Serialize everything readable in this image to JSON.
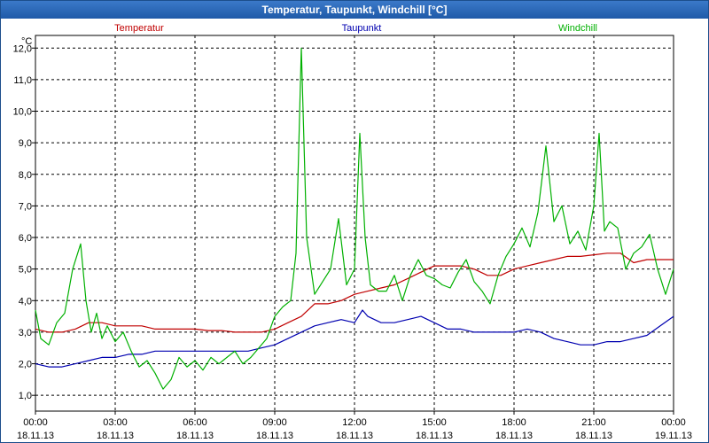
{
  "window": {
    "title": "Temperatur, Taupunkt, Windchill [°C]"
  },
  "chart_data": {
    "type": "line",
    "title": "Temperatur, Taupunkt, Windchill [°C]",
    "ylabel": "°C",
    "ylim": [
      0.5,
      12.4
    ],
    "yticks": [
      1.0,
      2.0,
      3.0,
      4.0,
      5.0,
      6.0,
      7.0,
      8.0,
      9.0,
      10.0,
      11.0,
      12.0
    ],
    "ytick_labels": [
      "1,0",
      "2,0",
      "3,0",
      "4,0",
      "5,0",
      "6,0",
      "7,0",
      "8,0",
      "9,0",
      "10,0",
      "11,0",
      "12,0"
    ],
    "xlim": [
      0,
      24
    ],
    "xticks": [
      {
        "h": 0,
        "time": "00:00",
        "date": "18.11.13"
      },
      {
        "h": 3,
        "time": "03:00",
        "date": "18.11.13"
      },
      {
        "h": 6,
        "time": "06:00",
        "date": "18.11.13"
      },
      {
        "h": 9,
        "time": "09:00",
        "date": "18.11.13"
      },
      {
        "h": 12,
        "time": "12:00",
        "date": "18.11.13"
      },
      {
        "h": 15,
        "time": "15:00",
        "date": "18.11.13"
      },
      {
        "h": 18,
        "time": "18:00",
        "date": "18.11.13"
      },
      {
        "h": 21,
        "time": "21:00",
        "date": "18.11.13"
      },
      {
        "h": 24,
        "time": "00:00",
        "date": "19.11.13"
      }
    ],
    "grid": true,
    "legend": "top",
    "series": [
      {
        "name": "Temperatur",
        "color": "#c00000",
        "x": [
          0,
          0.5,
          1,
          1.5,
          2,
          2.5,
          3,
          3.5,
          4,
          4.5,
          5,
          5.5,
          6,
          6.5,
          7,
          7.5,
          8,
          8.5,
          9,
          9.5,
          10,
          10.5,
          11,
          11.5,
          12,
          12.5,
          13,
          13.5,
          14,
          14.5,
          15,
          15.5,
          16,
          16.5,
          17,
          17.5,
          18,
          18.5,
          19,
          19.5,
          20,
          20.5,
          21,
          21.5,
          22,
          22.5,
          23,
          23.5,
          24
        ],
        "values": [
          3.1,
          3.0,
          3.0,
          3.1,
          3.3,
          3.3,
          3.2,
          3.2,
          3.2,
          3.1,
          3.1,
          3.1,
          3.1,
          3.05,
          3.05,
          3.0,
          3.0,
          3.0,
          3.1,
          3.3,
          3.5,
          3.9,
          3.9,
          4.0,
          4.2,
          4.3,
          4.4,
          4.5,
          4.7,
          4.9,
          5.1,
          5.1,
          5.1,
          5.0,
          4.8,
          4.8,
          5.0,
          5.1,
          5.2,
          5.3,
          5.4,
          5.4,
          5.45,
          5.5,
          5.5,
          5.2,
          5.3,
          5.3,
          5.3
        ]
      },
      {
        "name": "Taupunkt",
        "color": "#0000b0",
        "x": [
          0,
          0.5,
          1,
          1.5,
          2,
          2.5,
          3,
          3.5,
          4,
          4.5,
          5,
          5.5,
          6,
          6.5,
          7,
          7.5,
          8,
          8.5,
          9,
          9.5,
          10,
          10.5,
          11,
          11.5,
          12,
          12.3,
          12.5,
          13,
          13.5,
          14,
          14.5,
          15,
          15.5,
          16,
          16.5,
          17,
          17.5,
          18,
          18.5,
          19,
          19.5,
          20,
          20.5,
          21,
          21.5,
          22,
          22.5,
          23,
          23.5,
          24
        ],
        "values": [
          2.0,
          1.9,
          1.9,
          2.0,
          2.1,
          2.2,
          2.2,
          2.3,
          2.3,
          2.4,
          2.4,
          2.4,
          2.4,
          2.4,
          2.4,
          2.4,
          2.4,
          2.5,
          2.6,
          2.8,
          3.0,
          3.2,
          3.3,
          3.4,
          3.3,
          3.7,
          3.5,
          3.3,
          3.3,
          3.4,
          3.5,
          3.3,
          3.1,
          3.1,
          3.0,
          3.0,
          3.0,
          3.0,
          3.1,
          3.0,
          2.8,
          2.7,
          2.6,
          2.6,
          2.7,
          2.7,
          2.8,
          2.9,
          3.2,
          3.5
        ]
      },
      {
        "name": "Windchill",
        "color": "#00b000",
        "x": [
          0,
          0.2,
          0.5,
          0.8,
          1.1,
          1.4,
          1.7,
          1.9,
          2.1,
          2.3,
          2.5,
          2.7,
          3.0,
          3.3,
          3.6,
          3.9,
          4.2,
          4.5,
          4.8,
          5.1,
          5.4,
          5.7,
          6.0,
          6.3,
          6.6,
          6.9,
          7.2,
          7.5,
          7.8,
          8.1,
          8.4,
          8.7,
          9.0,
          9.3,
          9.6,
          9.8,
          10.0,
          10.2,
          10.5,
          10.8,
          11.1,
          11.4,
          11.7,
          12.0,
          12.2,
          12.4,
          12.6,
          12.9,
          13.2,
          13.5,
          13.8,
          14.1,
          14.4,
          14.7,
          15.0,
          15.3,
          15.6,
          15.9,
          16.2,
          16.5,
          16.8,
          17.1,
          17.4,
          17.7,
          18.0,
          18.3,
          18.6,
          18.9,
          19.2,
          19.5,
          19.8,
          20.1,
          20.4,
          20.7,
          21.0,
          21.2,
          21.4,
          21.6,
          21.9,
          22.2,
          22.5,
          22.8,
          23.1,
          23.4,
          23.7,
          24.0
        ],
        "values": [
          3.7,
          2.8,
          2.6,
          3.3,
          3.6,
          5.0,
          5.8,
          4.0,
          3.0,
          3.6,
          2.8,
          3.2,
          2.7,
          3.0,
          2.4,
          1.9,
          2.1,
          1.7,
          1.2,
          1.5,
          2.2,
          1.9,
          2.1,
          1.8,
          2.2,
          2.0,
          2.2,
          2.4,
          2.0,
          2.2,
          2.5,
          2.8,
          3.5,
          3.8,
          4.0,
          5.5,
          12.0,
          6.0,
          4.2,
          4.6,
          5.0,
          6.6,
          4.5,
          5.0,
          9.3,
          6.0,
          4.5,
          4.3,
          4.3,
          4.8,
          4.0,
          4.8,
          5.3,
          4.8,
          4.7,
          4.5,
          4.4,
          4.9,
          5.3,
          4.6,
          4.3,
          3.9,
          4.8,
          5.4,
          5.8,
          6.3,
          5.7,
          6.8,
          8.9,
          6.5,
          7.0,
          5.8,
          6.2,
          5.6,
          7.0,
          9.3,
          6.2,
          6.5,
          6.3,
          5.0,
          5.5,
          5.7,
          6.1,
          5.0,
          4.2,
          5.0
        ]
      }
    ]
  }
}
